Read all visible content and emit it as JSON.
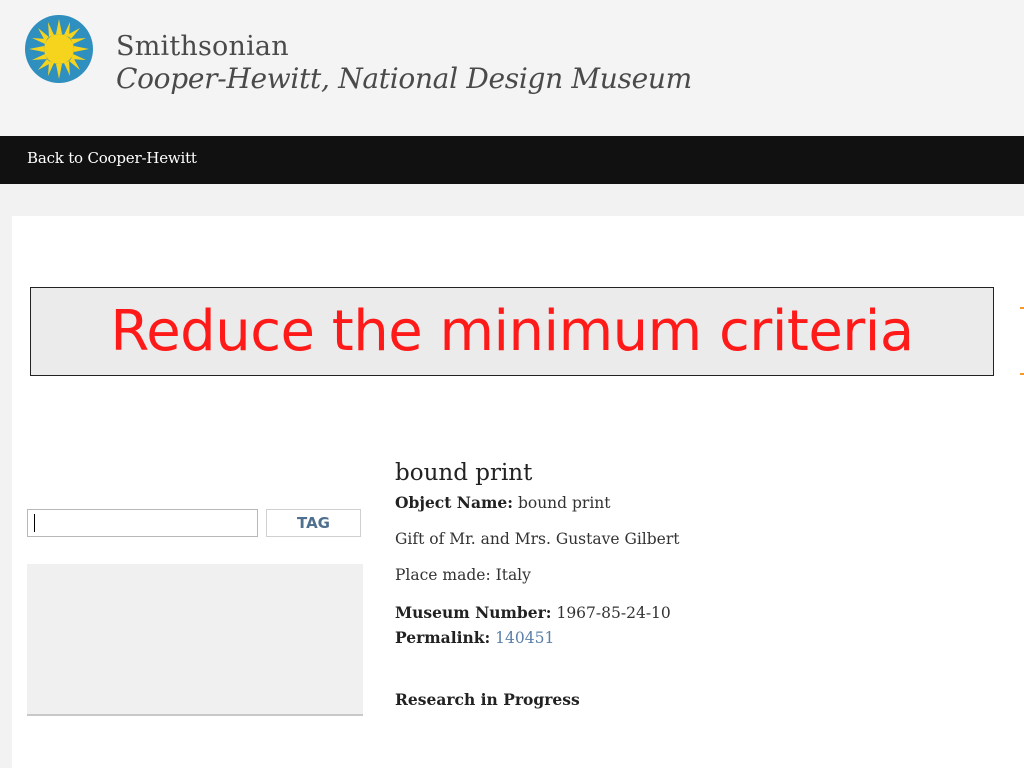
{
  "header": {
    "brand_line1": "Smithsonian",
    "brand_line2": "Cooper-Hewitt, National Design Museum",
    "logo_icon": "sun-logo-icon",
    "logo_colors": {
      "ring": "#2f8fbf",
      "sun": "#f6d31c"
    }
  },
  "nav": {
    "back_link": "Back to Cooper-Hewitt"
  },
  "overlay": {
    "text": "Reduce the minimum criteria",
    "text_color": "#ff1a1a"
  },
  "tagging": {
    "input_value": "",
    "button_label": "TAG"
  },
  "object": {
    "title": "bound print",
    "object_name_label": "Object Name:",
    "object_name_value": "bound print",
    "credit": "Gift of Mr. and Mrs. Gustave Gilbert",
    "place_made": "Place made: Italy",
    "museum_number_label": "Museum Number:",
    "museum_number_value": "1967-85-24-10",
    "permalink_label": "Permalink:",
    "permalink_value": "140451",
    "research_note": "Research in Progress"
  }
}
